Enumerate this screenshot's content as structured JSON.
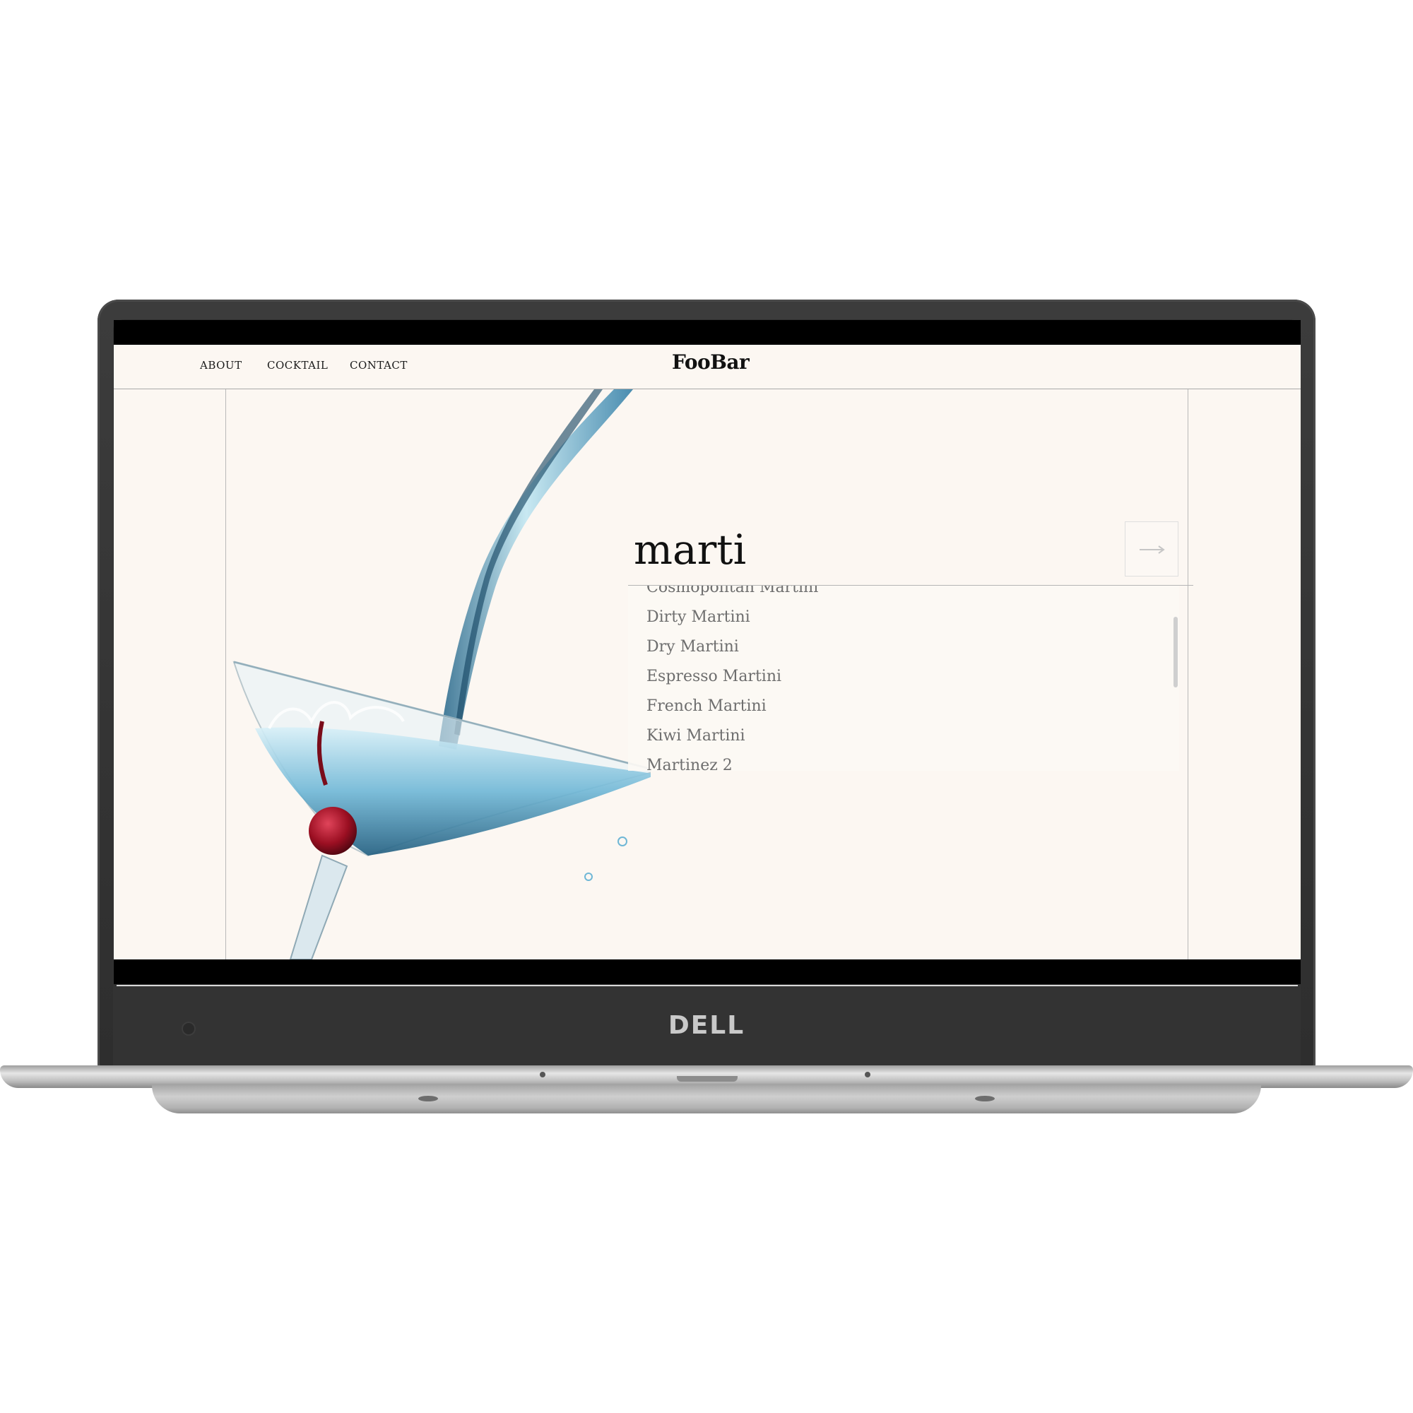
{
  "device": {
    "brand_logo": "DELL"
  },
  "site": {
    "logo": "FooBar",
    "nav": [
      {
        "label": "ABOUT"
      },
      {
        "label": "COCKTAIL"
      },
      {
        "label": "CONTACT"
      }
    ]
  },
  "search": {
    "value": "marti",
    "submit_icon": "arrow-right-icon",
    "suggestions": [
      "Cosmopolitan Martini",
      "Dirty Martini",
      "Dry Martini",
      "Espresso Martini",
      "French Martini",
      "Kiwi Martini",
      "Martinez 2"
    ]
  },
  "hero": {
    "image_icon": "martini-glass-pour-icon"
  },
  "colors": {
    "page_background": "#fcf7f2",
    "text_primary": "#111111",
    "suggestion_text": "#6e6e6e",
    "drink_blue": "#6fb7d6",
    "cherry": "#9b0f22"
  }
}
